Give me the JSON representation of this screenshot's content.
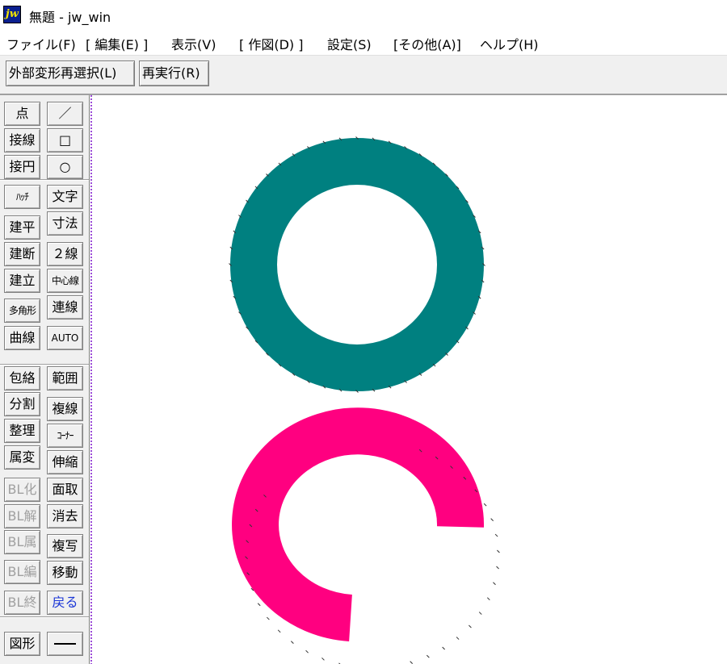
{
  "window": {
    "title": "無題 - jw_win",
    "app_icon_text": "jw"
  },
  "menu": [
    "ファイル(F)",
    "[ 編集(E) ]",
    "表示(V)",
    "[ 作図(D) ]",
    "設定(S)",
    "[その他(A)]",
    "ヘルプ(H)"
  ],
  "command_bar": {
    "reselect_label": "外部変形再選択(L)",
    "rerun_label": "再実行(R)"
  },
  "toolbar": {
    "left_column": [
      "点",
      "接線",
      "接円",
      "ﾊｯﾁ",
      "建平",
      "建断",
      "建立",
      "多角形",
      "曲線",
      "包絡",
      "分割",
      "整理",
      "属変",
      "BL化",
      "BL解",
      "BL属",
      "BL編",
      "BL終",
      "図形"
    ],
    "right_column": [
      "／",
      "□",
      "○",
      "文字",
      "寸法",
      "２線",
      "中心線",
      "連線",
      "AUTO",
      "範囲",
      "複線",
      "ｺｰﾅｰ",
      "伸縮",
      "面取",
      "消去",
      "複写",
      "移動",
      "戻る"
    ],
    "disabled_items": [
      "BL化",
      "BL解",
      "BL属",
      "BL編",
      "BL終"
    ],
    "highlight_item": "戻る"
  },
  "drawing": {
    "shapes": [
      {
        "type": "ring",
        "color": "#008080",
        "description_color": "teal"
      },
      {
        "type": "open-arc",
        "color": "#ff0080",
        "description_color": "magenta"
      }
    ],
    "boundary_line_color": "#9a4bd6"
  }
}
